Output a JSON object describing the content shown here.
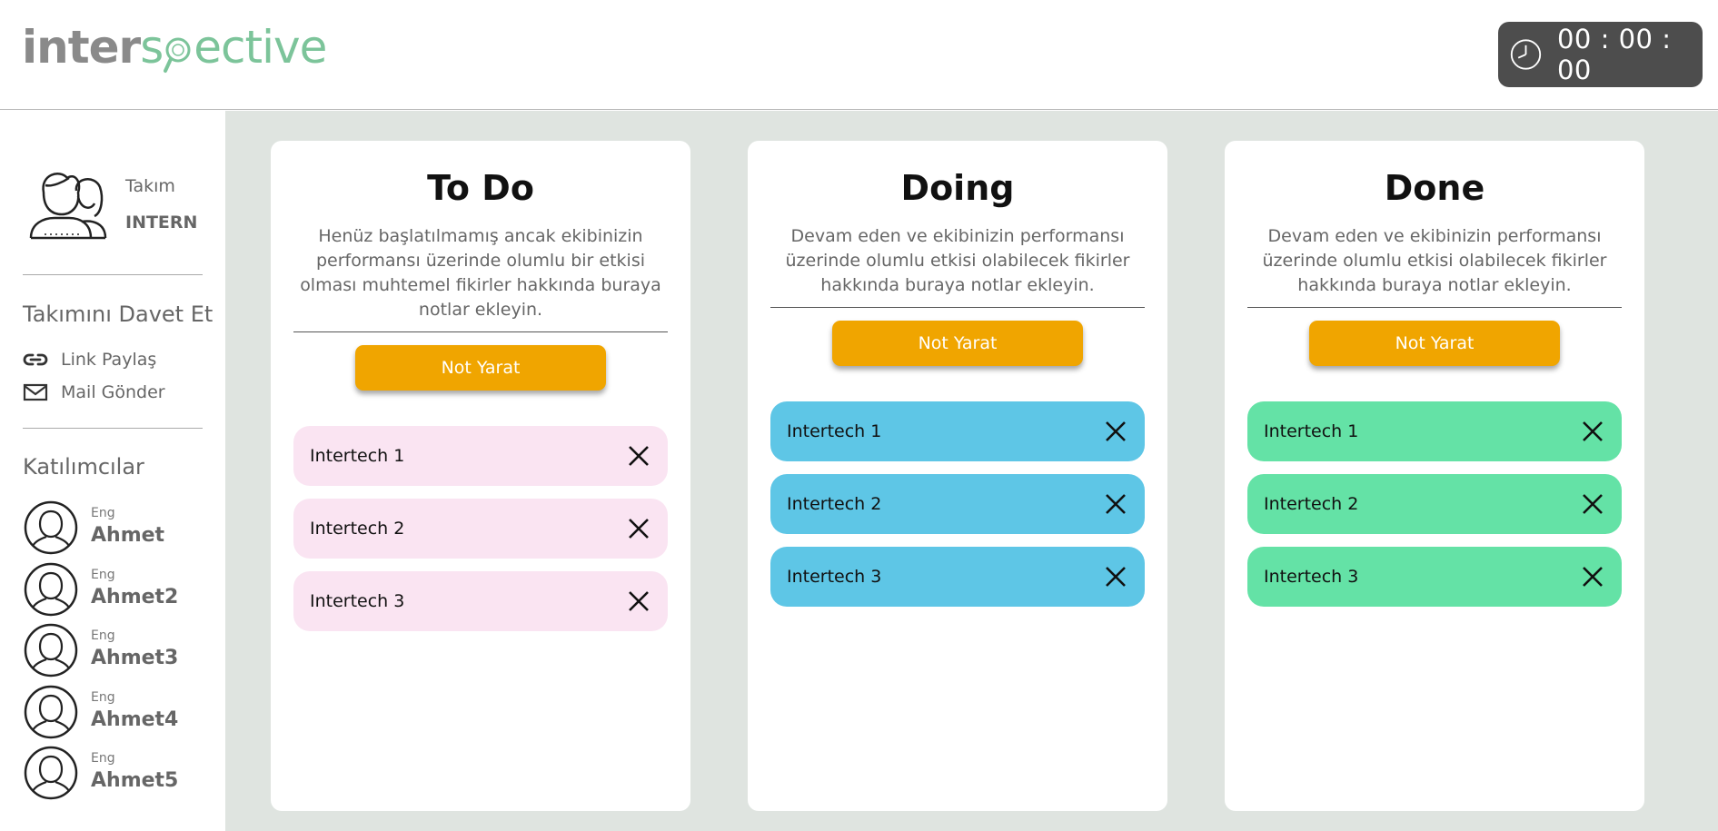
{
  "header": {
    "logo_part1": "inter",
    "logo_part2a": "s",
    "logo_part2b": "ective",
    "timer": "00 : 00 : 00"
  },
  "sidebar": {
    "team_label": "Takım",
    "team_name": "INTERN",
    "invite_title": "Takımını Davet Et",
    "share_link": "Link Paylaş",
    "send_mail": "Mail Gönder",
    "participants_title": "Katılımcılar",
    "participants": [
      {
        "role": "Eng",
        "name": "Ahmet"
      },
      {
        "role": "Eng",
        "name": "Ahmet2"
      },
      {
        "role": "Eng",
        "name": "Ahmet3"
      },
      {
        "role": "Eng",
        "name": "Ahmet4"
      },
      {
        "role": "Eng",
        "name": "Ahmet5"
      }
    ]
  },
  "columns": [
    {
      "title": "To Do",
      "description": "Henüz başlatılmamış ancak ekibinizin performansı üzerinde olumlu bir etkisi olması muhtemel fikirler hakkında buraya notlar ekleyin.",
      "button": "Not Yarat",
      "color": "#fae4f2",
      "notes": [
        "Intertech 1",
        "Intertech 2",
        "Intertech 3"
      ]
    },
    {
      "title": "Doing",
      "description": "Devam eden ve ekibinizin performansı üzerinde olumlu etkisi olabilecek fikirler hakkında buraya notlar ekleyin.",
      "button": "Not Yarat",
      "color": "#5ec6e6",
      "notes": [
        "Intertech 1",
        "Intertech 2",
        "Intertech 3"
      ]
    },
    {
      "title": "Done",
      "description": "Devam eden ve ekibinizin performansı üzerinde olumlu etkisi olabilecek fikirler hakkında buraya notlar ekleyin.",
      "button": "Not Yarat",
      "color": "#64e2a6",
      "notes": [
        "Intertech 1",
        "Intertech 2",
        "Intertech 3"
      ]
    }
  ],
  "colors": {
    "accent_button": "#f0a500",
    "background": "#dfe4e0",
    "logo_gray": "#8a8a8a",
    "logo_green": "#7cc49a",
    "timer_bg": "#4d4d4d"
  },
  "icons": {
    "timer": "clock-icon",
    "team": "team-avatar-icon",
    "link": "link-icon",
    "mail": "mail-icon",
    "participant": "user-avatar-icon",
    "note_delete": "close-icon"
  }
}
